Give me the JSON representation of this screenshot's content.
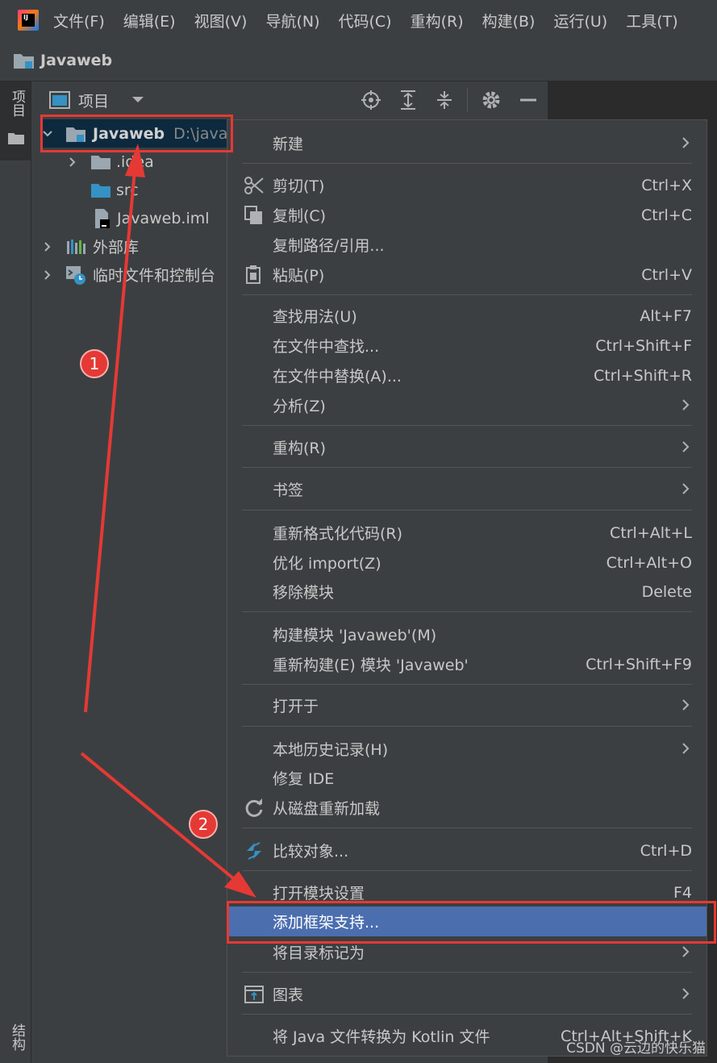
{
  "menubar": {
    "items": [
      "文件(F)",
      "编辑(E)",
      "视图(V)",
      "导航(N)",
      "代码(C)",
      "重构(R)",
      "构建(B)",
      "运行(U)",
      "工具(T)"
    ]
  },
  "navbar": {
    "project": "Javaweb"
  },
  "left_strip": {
    "project_tab": "项目",
    "structure_tab": "结构"
  },
  "panel": {
    "title": "项目",
    "tools": [
      "locate-icon",
      "expand-all-icon",
      "collapse-all-icon",
      "gear-icon",
      "minimize-icon"
    ]
  },
  "tree": {
    "root_name": "Javaweb",
    "root_path": "D:\\java",
    "idea": ".idea",
    "src": "src",
    "iml": "Javaweb.iml",
    "external_libs": "外部库",
    "scratches": "临时文件和控制台"
  },
  "context_menu": {
    "new": "新建",
    "cut": "剪切(T)",
    "cut_sc": "Ctrl+X",
    "copy": "复制(C)",
    "copy_sc": "Ctrl+C",
    "copy_path": "复制路径/引用...",
    "paste": "粘贴(P)",
    "paste_sc": "Ctrl+V",
    "find_usages": "查找用法(U)",
    "find_usages_sc": "Alt+F7",
    "find_in_files": "在文件中查找...",
    "find_in_files_sc": "Ctrl+Shift+F",
    "replace_in_files": "在文件中替换(A)...",
    "replace_in_files_sc": "Ctrl+Shift+R",
    "analyze": "分析(Z)",
    "refactor": "重构(R)",
    "bookmarks": "书签",
    "reformat": "重新格式化代码(R)",
    "reformat_sc": "Ctrl+Alt+L",
    "optimize_imports": "优化 import(Z)",
    "optimize_imports_sc": "Ctrl+Alt+O",
    "remove_module": "移除模块",
    "remove_module_sc": "Delete",
    "build_module": "构建模块 'Javaweb'(M)",
    "rebuild_module": "重新构建(E) 模块 'Javaweb'",
    "rebuild_module_sc": "Ctrl+Shift+F9",
    "open_in": "打开于",
    "local_history": "本地历史记录(H)",
    "repair_ide": "修复 IDE",
    "reload_from_disk": "从磁盘重新加载",
    "compare_with": "比较对象...",
    "compare_with_sc": "Ctrl+D",
    "open_module_settings": "打开模块设置",
    "open_module_settings_sc": "F4",
    "add_framework_support": "添加框架支持...",
    "mark_directory_as": "将目录标记为",
    "diagrams": "图表",
    "convert_kotlin": "将 Java 文件转换为 Kotlin 文件",
    "convert_kotlin_sc": "Ctrl+Alt+Shift+K"
  },
  "annotations": {
    "badge1": "1",
    "badge2": "2"
  },
  "watermark": "CSDN @云边的快乐猫",
  "colors": {
    "highlight": "#4b6eaf",
    "annotation_red": "#e53935",
    "folder_blue": "#3592c4"
  }
}
